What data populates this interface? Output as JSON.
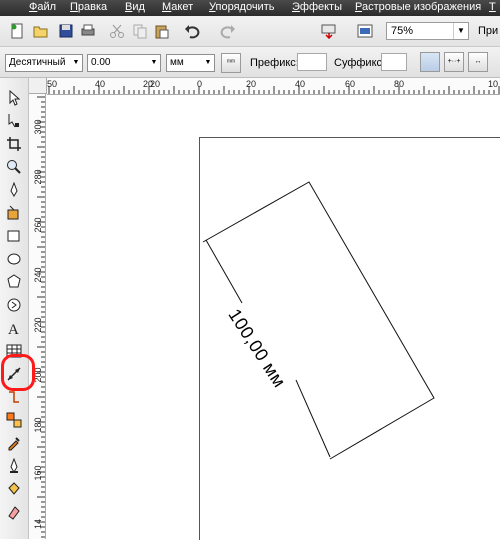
{
  "menu": {
    "items": [
      "Файл",
      "Правка",
      "Вид",
      "Макет",
      "Упорядочить",
      "Эффекты",
      "Растровые изображения",
      "Т"
    ]
  },
  "toolbar": {
    "zoom_value": "75%",
    "cut_off_label": "При",
    "icons": [
      "new-document-icon",
      "open-icon",
      "save-icon",
      "print-icon",
      "cut-icon",
      "copy-icon",
      "paste-icon",
      "undo-icon",
      "redo-icon",
      "import-icon",
      "export-icon",
      "application-launcher-icon"
    ]
  },
  "property_bar": {
    "dimension_style": "Десятичный",
    "precision": "0.00",
    "units": "мм",
    "prefix_label": "Префикс:",
    "prefix_value": "",
    "suffix_label": "Суффикс:",
    "suffix_value": ""
  },
  "ruler_top": {
    "ticks": [
      "50",
      "40",
      "20",
      "20",
      "0",
      "20",
      "40",
      "60",
      "80",
      "10"
    ]
  },
  "ruler_left": {
    "ticks": [
      "300",
      "280",
      "260",
      "240",
      "220",
      "200",
      "180",
      "160",
      "14"
    ]
  },
  "drawing": {
    "dimension_text": "100,00 мм"
  },
  "colors": {
    "menubar_bg": "#333333",
    "highlight": "#ff1a1a"
  }
}
